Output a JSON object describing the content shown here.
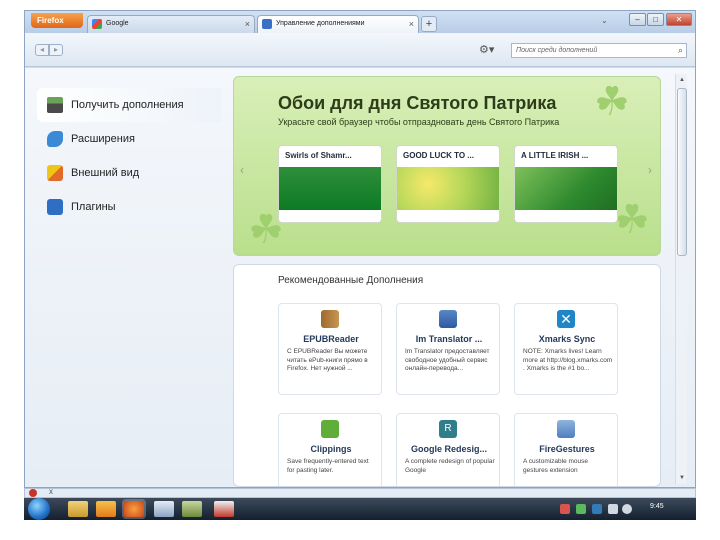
{
  "browser": {
    "menu_button": "Firefox",
    "tabs": [
      {
        "label": "Google"
      },
      {
        "label": "Управление дополнениями"
      }
    ],
    "new_tab": "+",
    "tab_close": "×",
    "window_controls": {
      "minimize": "–",
      "maximize": "□",
      "close": "✕"
    }
  },
  "navbar": {
    "back": "◂",
    "forward": "▸",
    "tools_icon": "gear-icon",
    "search_placeholder": "Поиск среди дополнений",
    "search_icon": "⌕"
  },
  "sidebar": {
    "items": [
      {
        "label": "Получить дополнения",
        "icon": "download-addons-icon",
        "selected": true
      },
      {
        "label": "Расширения",
        "icon": "puzzle-icon",
        "selected": false
      },
      {
        "label": "Внешний вид",
        "icon": "appearance-icon",
        "selected": false
      },
      {
        "label": "Плагины",
        "icon": "plugin-icon",
        "selected": false
      }
    ]
  },
  "promo": {
    "title": "Обои для дня Святого Патрика",
    "subtitle": "Украсьте свой браузер чтобы отпраздновать день Святого Патрика",
    "prev_arrow": "‹",
    "next_arrow": "›",
    "cards": [
      {
        "label": "Swirls of Shamr..."
      },
      {
        "label": "GOOD LUCK TO ..."
      },
      {
        "label": "A LITTLE IRISH ..."
      }
    ],
    "accent": "#b9df8c"
  },
  "recommended": {
    "title": "Рекомендованные Дополнения",
    "addons": [
      {
        "name": "EPUBReader",
        "description": "С EPUBReader Вы можете читать ePub-книги прямо в Firefox. Нет нужной ...",
        "icon": "book-icon"
      },
      {
        "name": "Im Translator ...",
        "description": "Im Translator предоставляет свободное удобный сервис онлайн-перевода...",
        "icon": "translator-icon"
      },
      {
        "name": "Xmarks Sync",
        "description": "NOTE: Xmarks lives! Learn more at http://blog.xmarks.com . Xmarks is the #1 bo...",
        "icon": "xmarks-icon"
      },
      {
        "name": "Clippings",
        "description": "Save frequently-entered text for pasting later.",
        "icon": "clippings-icon"
      },
      {
        "name": "Google Redesig...",
        "description": "A complete redesign of popular Google",
        "icon": "google-redesign-icon"
      },
      {
        "name": "FireGestures",
        "description": "A customizable mouse gestures extension",
        "icon": "firegestures-icon"
      }
    ]
  },
  "scrollbar": {
    "up": "▲",
    "down": "▼"
  },
  "addonbar": {
    "close": "x"
  },
  "taskbar": {
    "clock": "9:45"
  }
}
